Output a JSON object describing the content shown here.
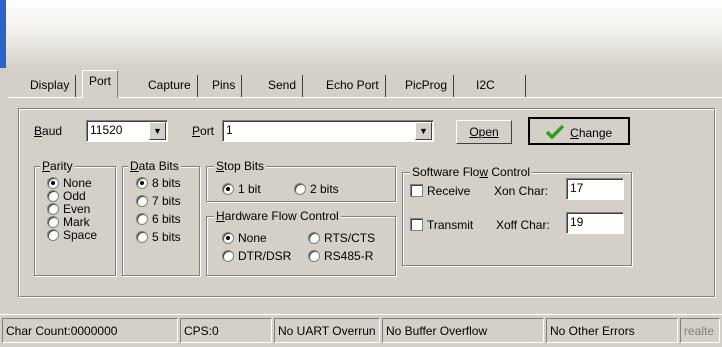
{
  "tabs": [
    {
      "label": "Display"
    },
    {
      "label": "Port",
      "active": true
    },
    {
      "label": "Capture"
    },
    {
      "label": "Pins"
    },
    {
      "label": "Send"
    },
    {
      "label": "Echo Port"
    },
    {
      "label": "PicProg"
    },
    {
      "label": "I2C"
    }
  ],
  "port_panel": {
    "baud": {
      "label_pre": "",
      "label_u": "B",
      "label_post": "aud",
      "value": "11520"
    },
    "port": {
      "label_pre": "",
      "label_u": "P",
      "label_post": "ort",
      "value": "1"
    },
    "open_button": "Open",
    "change_button": {
      "pre": "",
      "u": "C",
      "post": "hange"
    },
    "parity": {
      "title_pre": "",
      "title_u": "P",
      "title_post": "arity",
      "options": [
        {
          "label": "None",
          "selected": true
        },
        {
          "label": "Odd",
          "selected": false
        },
        {
          "label": "Even",
          "selected": false
        },
        {
          "label": "Mark",
          "selected": false
        },
        {
          "label": "Space",
          "selected": false
        }
      ]
    },
    "data_bits": {
      "title_pre": "",
      "title_u": "D",
      "title_post": "ata Bits",
      "options": [
        {
          "label": "8 bits",
          "selected": true
        },
        {
          "label": "7 bits",
          "selected": false
        },
        {
          "label": "6 bits",
          "selected": false
        },
        {
          "label": "5 bits",
          "selected": false
        }
      ]
    },
    "stop_bits": {
      "title_pre": "",
      "title_u": "S",
      "title_post": "top Bits",
      "options": [
        {
          "label": "1 bit",
          "selected": true
        },
        {
          "label": "2 bits",
          "selected": false
        }
      ]
    },
    "hardware_flow": {
      "title_pre": "",
      "title_u": "H",
      "title_post": "ardware Flow Control",
      "options": [
        {
          "label": "None",
          "selected": true
        },
        {
          "label": "RTS/CTS",
          "selected": false
        },
        {
          "label": "DTR/DSR",
          "selected": false
        },
        {
          "label": "RS485-R",
          "selected": false
        }
      ]
    },
    "software_flow": {
      "title_pre": "Software Flo",
      "title_u": "w",
      "title_post": " Control",
      "receive_label": "Receive",
      "transmit_label": "Transmit",
      "xon_label": "Xon Char:",
      "xon_value": "17",
      "xoff_label": "Xoff Char:",
      "xoff_value": "19"
    }
  },
  "status_bar": {
    "char_count": "Char Count:0000000",
    "cps": "CPS:0",
    "uart": "No UART Overrun",
    "buffer": "No Buffer Overflow",
    "errors": "No Other Errors",
    "extra": "realte"
  },
  "colors": {
    "face": "#d4d0c8",
    "accent": "#2a64c8",
    "check_green": "#2e9e1e"
  }
}
